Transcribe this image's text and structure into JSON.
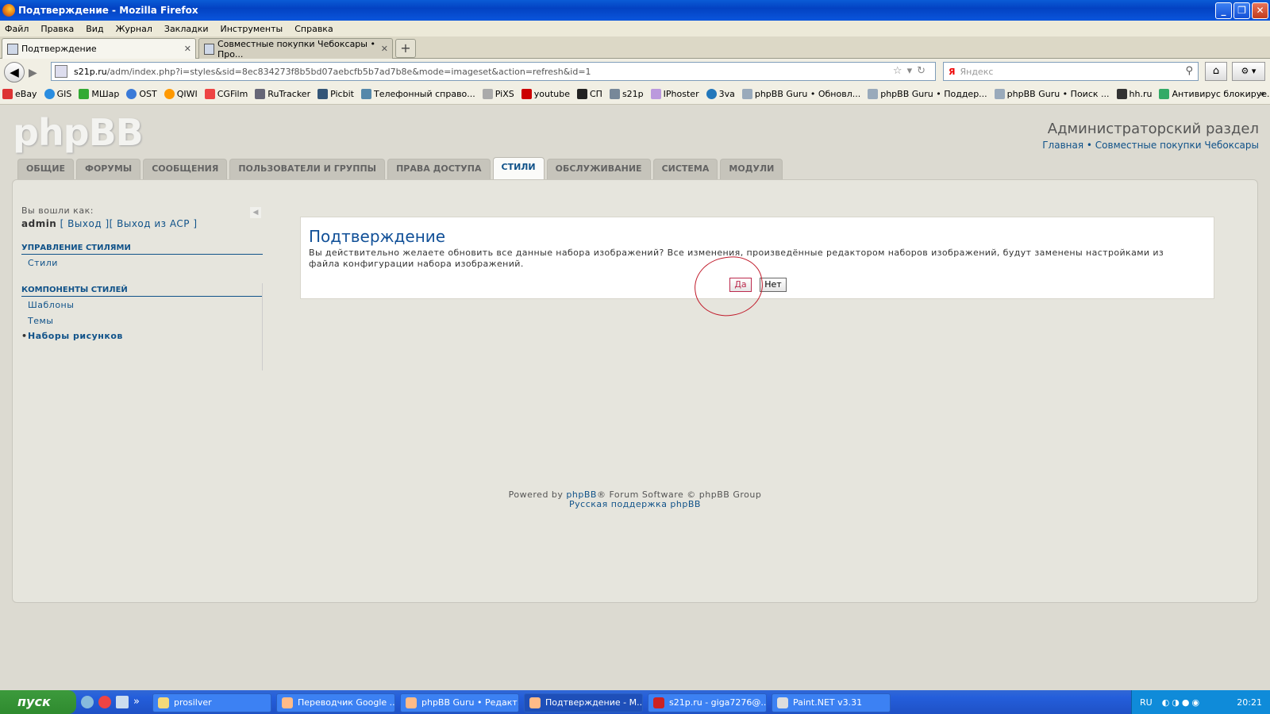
{
  "window": {
    "title": "Подтверждение - Mozilla Firefox"
  },
  "menu": [
    "Файл",
    "Правка",
    "Вид",
    "Журнал",
    "Закладки",
    "Инструменты",
    "Справка"
  ],
  "tabs": [
    {
      "label": "Подтверждение"
    },
    {
      "label": "Совместные покупки Чебоксары • Про..."
    }
  ],
  "url": {
    "domain": "s21p.ru",
    "path": "/adm/index.php?i=styles&sid=8ec834273f8b5bd07aebcfb5b7ad7b8e&mode=imageset&action=refresh&id=1"
  },
  "search": {
    "placeholder": "Яндекс"
  },
  "bookmarks": [
    "eBay",
    "GIS",
    "МШар",
    "OST",
    "QIWI",
    "CGFilm",
    "RuTracker",
    "Picbit",
    "Телефонный справо...",
    "PiXS",
    "youtube",
    "СП",
    "s21p",
    "IPhoster",
    "3va",
    "phpBB Guru • Обновл...",
    "phpBB Guru • Поддер...",
    "phpBB Guru • Поиск ...",
    "hh.ru",
    "Антивирус блокируе..."
  ],
  "acp": {
    "logo": "phpBB",
    "title": "Администраторский раздел",
    "links": "Главная • Совместные покупки Чебоксары",
    "navtabs": [
      "ОБЩИЕ",
      "ФОРУМЫ",
      "СООБЩЕНИЯ",
      "ПОЛЬЗОВАТЕЛИ И ГРУППЫ",
      "ПРАВА ДОСТУПА",
      "СТИЛИ",
      "ОБСЛУЖИВАНИЕ",
      "СИСТЕМА",
      "МОДУЛИ"
    ],
    "active_tab": "СТИЛИ"
  },
  "sidebar": {
    "logged_as": "Вы вошли как:",
    "user": "admin",
    "logout": "Выход",
    "logout_acp": "Выход из ACP",
    "section1": "УПРАВЛЕНИЕ СТИЛЯМИ",
    "item_styles": "Стили",
    "section2": "КОМПОНЕНТЫ СТИЛЕЙ",
    "item_templates": "Шаблоны",
    "item_themes": "Темы",
    "item_imagesets": "Наборы рисунков"
  },
  "confirm": {
    "title": "Подтверждение",
    "text": "Вы действительно желаете обновить все данные набора изображений? Все изменения, произведённые редактором наборов изображений, будут заменены настройками из файла конфигурации набора изображений.",
    "yes": "Да",
    "no": "Нет"
  },
  "footer": {
    "powered_pre": "Powered by ",
    "powered_link": "phpBB",
    "powered_post": "® Forum Software © phpBB Group",
    "support": "Русская поддержка phpBB"
  },
  "taskbar": {
    "start": "пуск",
    "items": [
      "prosilver",
      "Переводчик Google ...",
      "phpBB Guru • Редакт...",
      "Подтверждение - M...",
      "s21p.ru - giga7276@...",
      "Paint.NET v3.31"
    ],
    "lang": "RU",
    "clock": "20:21"
  }
}
